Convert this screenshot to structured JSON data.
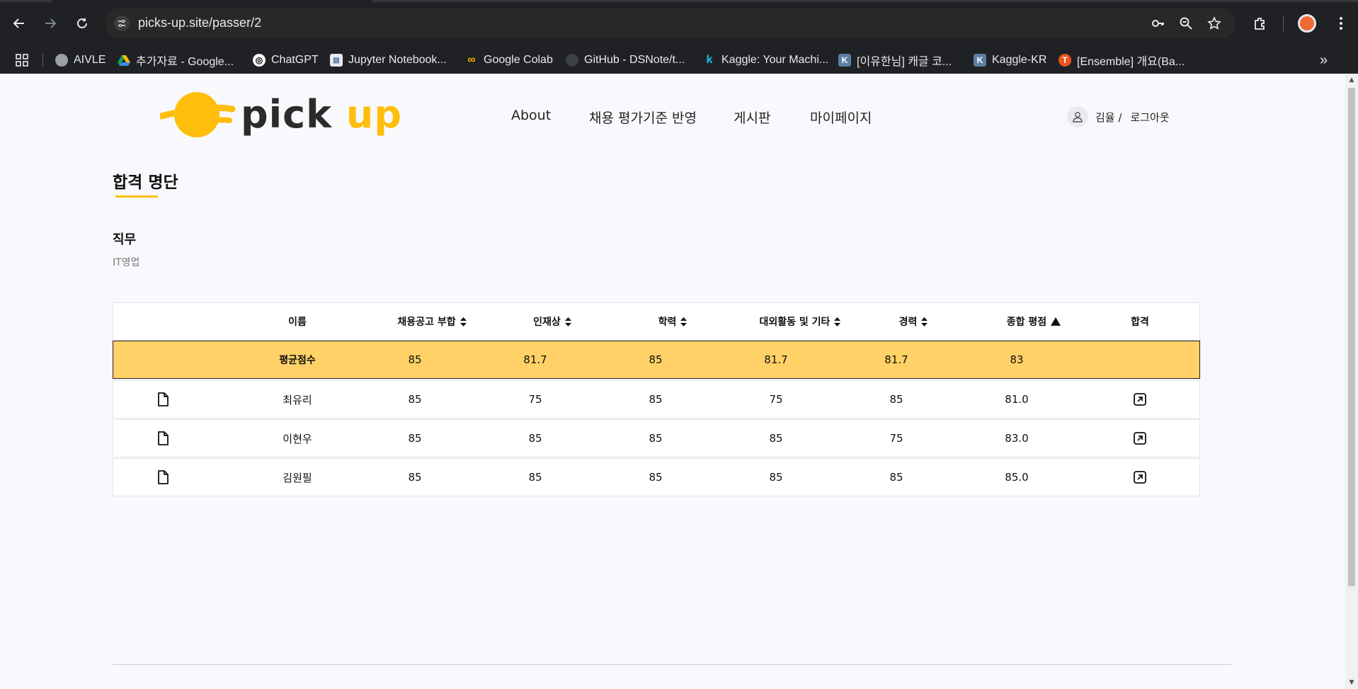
{
  "browser": {
    "url": "picks-up.site/passer/2",
    "bookmarks": [
      {
        "label": "AIVLE",
        "icon": "globe-icon",
        "color": "#e8eaed"
      },
      {
        "label": "추가자료 - Google...",
        "icon": "google-drive-icon",
        "color": "#4285f4"
      },
      {
        "label": "ChatGPT",
        "icon": "chatgpt-icon",
        "color": "#ffffff"
      },
      {
        "label": "Jupyter Notebook...",
        "icon": "jupyter-icon",
        "color": "#8ab4f8"
      },
      {
        "label": "Google Colab",
        "icon": "colab-icon",
        "color": "#f9ab00"
      },
      {
        "label": "GitHub - DSNote/t...",
        "icon": "github-icon",
        "color": "#e8eaed"
      },
      {
        "label": "Kaggle: Your Machi...",
        "icon": "kaggle-icon",
        "color": "#20beff"
      },
      {
        "label": "[이유한님] 캐글 코...",
        "icon": "kaggle-kr-icon",
        "color": "#5b7ea3"
      },
      {
        "label": "Kaggle-KR",
        "icon": "kaggle-kr-icon",
        "color": "#5b7ea3"
      },
      {
        "label": "[Ensemble] 개요(Ba...",
        "icon": "tistory-icon",
        "color": "#eb531f"
      }
    ]
  },
  "site": {
    "logo": {
      "text_main": "pick ",
      "text_accent": "up",
      "accent_color": "#ffbe0b"
    },
    "nav": [
      "About",
      "채용 평가기준 반영",
      "게시판",
      "마이페이지"
    ],
    "user": {
      "name": "김율 /",
      "logout": "로그아웃"
    }
  },
  "main": {
    "title": "합격 명단",
    "job_label": "직무",
    "job_value": "IT영업",
    "table": {
      "headers": [
        "이름",
        "채용공고 부합",
        "인재상",
        "학력",
        "대외활동 및 기타",
        "경력",
        "종합 평점",
        "합격"
      ],
      "avg_row": {
        "label": "평균점수",
        "values": [
          "85",
          "81.7",
          "85",
          "81.7",
          "81.7",
          "83"
        ],
        "color": "#ffd166"
      },
      "rows": [
        {
          "name": "최유리",
          "values": [
            "85",
            "75",
            "85",
            "75",
            "85",
            "81.0"
          ]
        },
        {
          "name": "이현우",
          "values": [
            "85",
            "85",
            "85",
            "85",
            "75",
            "83.0"
          ]
        },
        {
          "name": "김원필",
          "values": [
            "85",
            "85",
            "85",
            "85",
            "85",
            "85.0"
          ]
        }
      ]
    }
  }
}
